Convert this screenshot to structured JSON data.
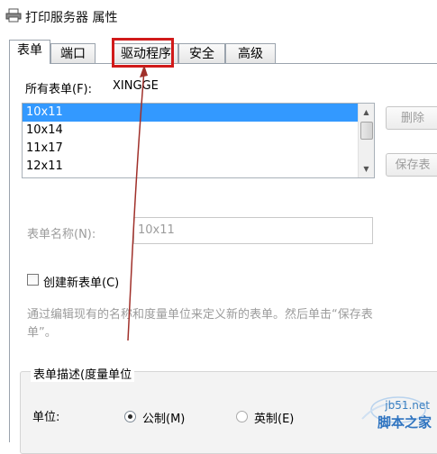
{
  "window": {
    "title": "打印服务器 属性",
    "icon": "printer-icon"
  },
  "tabs": [
    {
      "label": "表单",
      "active": true
    },
    {
      "label": "端口",
      "active": false
    },
    {
      "label": "驱动程序",
      "active": false
    },
    {
      "label": "安全",
      "active": false
    },
    {
      "label": "高级",
      "active": false
    }
  ],
  "forms": {
    "all_forms_label": "所有表单(F):",
    "server_name": "XINGGE",
    "list": [
      "10x11",
      "10x14",
      "11x17",
      "12x11"
    ],
    "selected": "10x11",
    "delete_button": "删除",
    "save_button": "保存表"
  },
  "form_name": {
    "label": "表单名称(N):",
    "value": "10x11"
  },
  "create_new": {
    "label": "创建新表单(C)",
    "checked": false
  },
  "description": "通过编辑现有的名称和度量单位来定义新的表单。然后单击“保存表单”。",
  "form_description": {
    "title": "表单描述(度量单位",
    "unit_label": "单位:",
    "metric_label": "公制(M)",
    "english_label": "英制(E)",
    "selected_unit": "metric"
  },
  "annotation": {
    "highlight_color": "#d11a1a",
    "arrow_color": "#a0302a"
  },
  "watermark": {
    "url": "jb51.net",
    "name": "脚本之家"
  }
}
